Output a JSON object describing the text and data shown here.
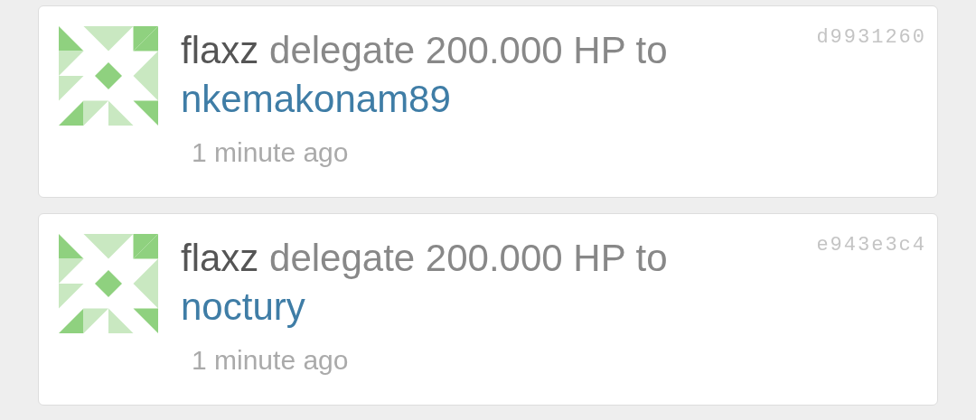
{
  "activities": [
    {
      "actor": "flaxz",
      "action": "delegate 200.000 HP to",
      "recipient": "nkemakonam89",
      "time": "1 minute ago",
      "hash": "d9931260"
    },
    {
      "actor": "flaxz",
      "action": "delegate 200.000 HP to",
      "recipient": "noctury",
      "time": "1 minute ago",
      "hash": "e943e3c4"
    }
  ]
}
